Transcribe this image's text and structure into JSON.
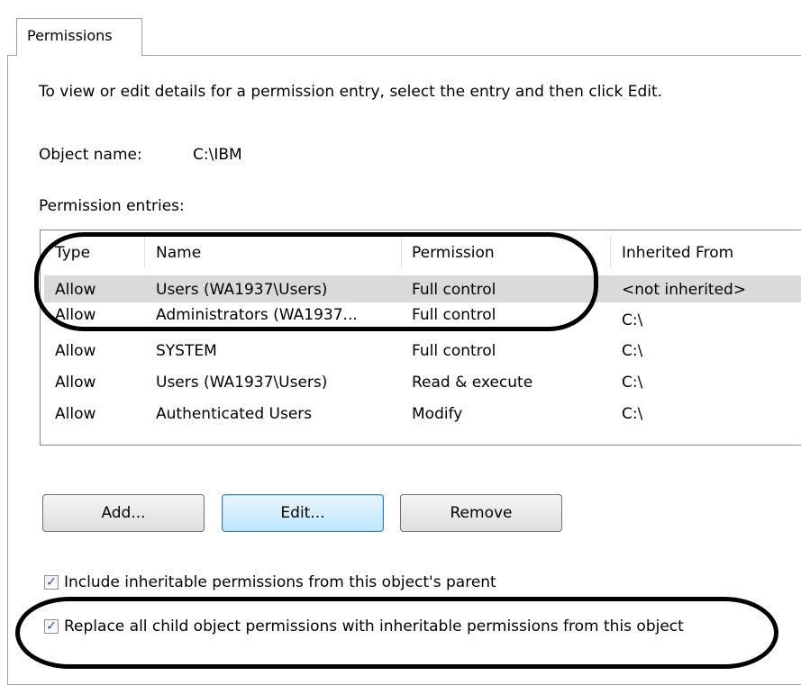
{
  "tab": {
    "label": "Permissions"
  },
  "instruction": "To view or edit details for a permission entry, select the entry and then click Edit.",
  "object": {
    "label": "Object name:",
    "value": "C:\\IBM"
  },
  "entries_label": "Permission entries:",
  "table": {
    "headers": [
      "Type",
      "Name",
      "Permission",
      "Inherited From"
    ],
    "rows": [
      [
        "Allow",
        "Users (WA1937\\Users)",
        "Full control",
        "<not inherited>"
      ],
      [
        "Allow",
        "Administrators (WA1937...",
        "Full control",
        "C:\\"
      ],
      [
        "Allow",
        "SYSTEM",
        "Full control",
        "C:\\"
      ],
      [
        "Allow",
        "Users (WA1937\\Users)",
        "Read & execute",
        "C:\\"
      ],
      [
        "Allow",
        "Authenticated Users",
        "Modify",
        "C:\\"
      ]
    ]
  },
  "buttons": {
    "add": "Add...",
    "edit": "Edit...",
    "remove": "Remove"
  },
  "checkboxes": {
    "include": {
      "label": "Include inheritable permissions from this object's parent",
      "checked": true
    },
    "replace": {
      "label": "Replace all child object permissions with inheritable permissions from this object",
      "checked": true
    }
  },
  "colors": {
    "selection": "#dadada",
    "accent": "#3c7fb1",
    "annotation": "#000000"
  }
}
